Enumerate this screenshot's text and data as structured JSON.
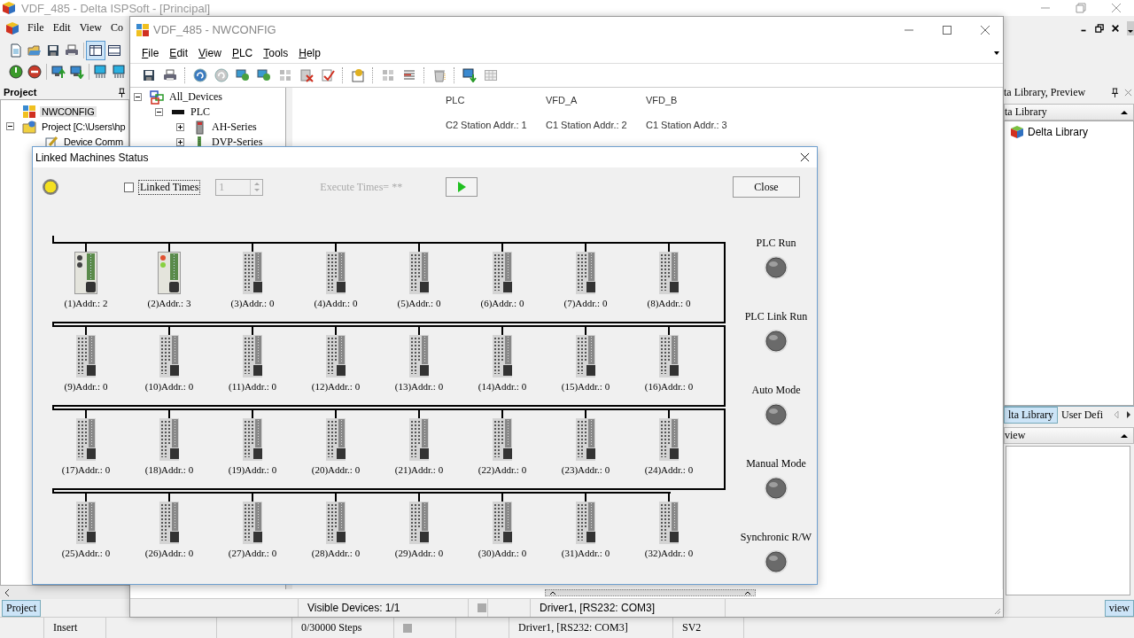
{
  "ispsoft": {
    "title": "VDF_485 - Delta ISPSoft - [Principal]",
    "menu": [
      "File",
      "Edit",
      "View",
      "Co"
    ],
    "project_panel": {
      "title": "Project",
      "tree": [
        {
          "label": "NWCONFIG",
          "selected": true
        },
        {
          "label": "Project [C:\\Users\\hp",
          "selected": false,
          "expanded": true,
          "children": [
            {
              "label": "Device Comm",
              "selected": false
            }
          ]
        }
      ],
      "tab": {
        "label": "Project",
        "selected": true
      }
    },
    "library_panel": {
      "title": "ta Library, Preview",
      "section": "ta Library",
      "items": [
        "Delta Library"
      ],
      "tabs": [
        {
          "label": "lta Library",
          "selected": true
        },
        {
          "label": "User Defi",
          "selected": false
        }
      ],
      "preview_title": "view",
      "tab": {
        "label": "view",
        "selected": true
      }
    },
    "status_bar": [
      "Insert",
      "0/30000 Steps",
      "Driver1, [RS232: COM3]",
      "SV2"
    ]
  },
  "nwconfig": {
    "title": "VDF_485 - NWCONFIG",
    "menu": [
      "File",
      "Edit",
      "View",
      "PLC",
      "Tools",
      "Help"
    ],
    "tree": [
      {
        "label": "All_Devices",
        "expanded": true,
        "children": [
          {
            "label": "PLC",
            "expanded": true,
            "children": [
              {
                "label": "AH-Series",
                "expanded": false
              },
              {
                "label": "DVP-Series",
                "expanded": false
              }
            ]
          }
        ]
      }
    ],
    "stations": [
      {
        "name": "PLC",
        "address": "C2 Station Addr.: 1"
      },
      {
        "name": "VFD_A",
        "address": "C1 Station Addr.: 2"
      },
      {
        "name": "VFD_B",
        "address": "C1 Station Addr.: 3"
      }
    ],
    "status_bar": [
      "Visible Devices: 1/1",
      "Driver1, [RS232: COM3]"
    ]
  },
  "dialog": {
    "title": "Linked Machines Status",
    "status_led": {
      "on": true
    },
    "linked_times": {
      "label": "Linked Times",
      "checked": false
    },
    "times_field": {
      "value": "1",
      "disabled": true
    },
    "execute_label": {
      "text": "Execute Times= **",
      "disabled": true
    },
    "close_button": "Close",
    "devices": [
      {
        "label": "(1)Addr.: 2",
        "kind": "plc",
        "lit": false
      },
      {
        "label": "(2)Addr.: 3",
        "kind": "plc",
        "lit": true
      },
      {
        "label": "(3)Addr.: 0",
        "kind": "empty"
      },
      {
        "label": "(4)Addr.: 0",
        "kind": "empty"
      },
      {
        "label": "(5)Addr.: 0",
        "kind": "empty"
      },
      {
        "label": "(6)Addr.: 0",
        "kind": "empty"
      },
      {
        "label": "(7)Addr.: 0",
        "kind": "empty"
      },
      {
        "label": "(8)Addr.: 0",
        "kind": "empty"
      },
      {
        "label": "(9)Addr.: 0",
        "kind": "empty"
      },
      {
        "label": "(10)Addr.: 0",
        "kind": "empty"
      },
      {
        "label": "(11)Addr.: 0",
        "kind": "empty"
      },
      {
        "label": "(12)Addr.: 0",
        "kind": "empty"
      },
      {
        "label": "(13)Addr.: 0",
        "kind": "empty"
      },
      {
        "label": "(14)Addr.: 0",
        "kind": "empty"
      },
      {
        "label": "(15)Addr.: 0",
        "kind": "empty"
      },
      {
        "label": "(16)Addr.: 0",
        "kind": "empty"
      },
      {
        "label": "(17)Addr.: 0",
        "kind": "empty"
      },
      {
        "label": "(18)Addr.: 0",
        "kind": "empty"
      },
      {
        "label": "(19)Addr.: 0",
        "kind": "empty"
      },
      {
        "label": "(20)Addr.: 0",
        "kind": "empty"
      },
      {
        "label": "(21)Addr.: 0",
        "kind": "empty"
      },
      {
        "label": "(22)Addr.: 0",
        "kind": "empty"
      },
      {
        "label": "(23)Addr.: 0",
        "kind": "empty"
      },
      {
        "label": "(24)Addr.: 0",
        "kind": "empty"
      },
      {
        "label": "(25)Addr.: 0",
        "kind": "empty"
      },
      {
        "label": "(26)Addr.: 0",
        "kind": "empty"
      },
      {
        "label": "(27)Addr.: 0",
        "kind": "empty"
      },
      {
        "label": "(28)Addr.: 0",
        "kind": "empty"
      },
      {
        "label": "(29)Addr.: 0",
        "kind": "empty"
      },
      {
        "label": "(30)Addr.: 0",
        "kind": "empty"
      },
      {
        "label": "(31)Addr.: 0",
        "kind": "empty"
      },
      {
        "label": "(32)Addr.: 0",
        "kind": "empty"
      }
    ],
    "indicators": [
      {
        "label": "PLC Run",
        "on": false
      },
      {
        "label": "PLC Link Run",
        "on": false
      },
      {
        "label": "Auto Mode",
        "on": false
      },
      {
        "label": "Manual Mode",
        "on": false
      },
      {
        "label": "Synchronic R/W",
        "on": false
      }
    ]
  }
}
